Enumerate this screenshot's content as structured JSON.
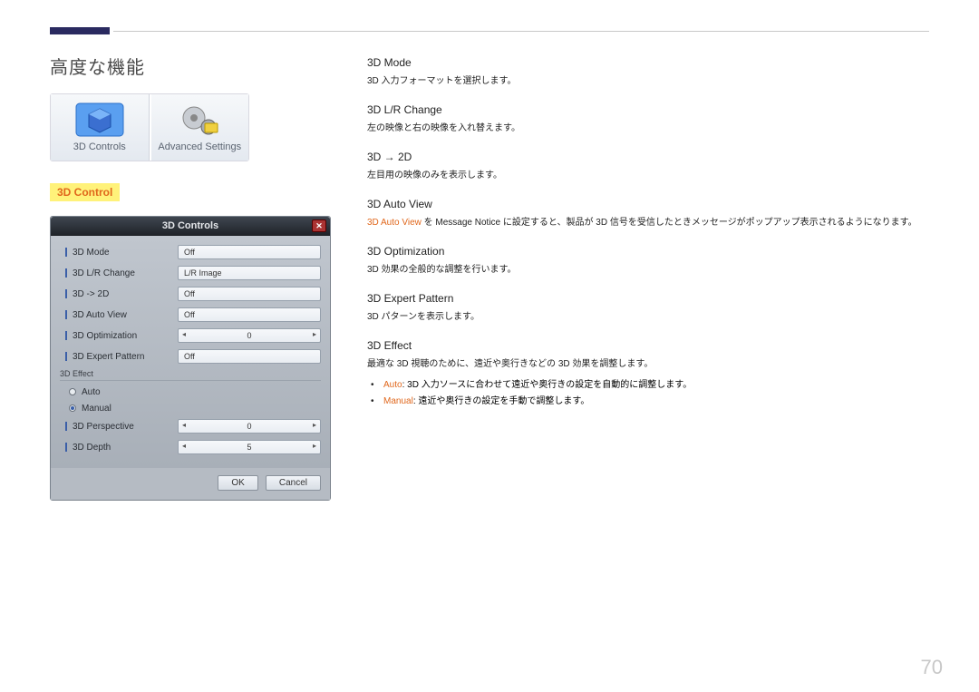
{
  "page_title": "高度な機能",
  "tiles": [
    {
      "label": "3D Controls"
    },
    {
      "label": "Advanced Settings"
    }
  ],
  "section_highlight": "3D Control",
  "dialog": {
    "title": "3D Controls",
    "close_glyph": "✕",
    "rows": [
      {
        "label": "3D Mode",
        "value": "Off"
      },
      {
        "label": "3D L/R Change",
        "value": "L/R Image"
      },
      {
        "label": "3D -> 2D",
        "value": "Off"
      },
      {
        "label": "3D Auto View",
        "value": "Off"
      },
      {
        "label": "3D Optimization",
        "value": "0",
        "spinner": true
      },
      {
        "label": "3D Expert Pattern",
        "value": "Off"
      }
    ],
    "effect_group_label": "3D Effect",
    "radios": [
      {
        "label": "Auto",
        "on": false
      },
      {
        "label": "Manual",
        "on": true
      }
    ],
    "effect_rows": [
      {
        "label": "3D Perspective",
        "value": "0",
        "spinner": true
      },
      {
        "label": "3D Depth",
        "value": "5",
        "spinner": true
      }
    ],
    "ok_label": "OK",
    "cancel_label": "Cancel"
  },
  "defs": [
    {
      "h": "3D Mode",
      "p": "3D 入力フォーマットを選択します。"
    },
    {
      "h": "3D L/R Change",
      "p": "左の映像と右の映像を入れ替えます。"
    },
    {
      "h": "3D → 2D",
      "p": "左目用の映像のみを表示します。"
    },
    {
      "h": "3D Auto View",
      "p_pre": "3D Auto View",
      "p_mid": " を Message Notice に設定すると、製品が 3D 信号を受信したときメッセージがポップアップ表示されるようになります。"
    },
    {
      "h": "3D Optimization",
      "p": "3D 効果の全般的な調整を行います。"
    },
    {
      "h": "3D Expert Pattern",
      "p": "3D パターンを表示します。"
    },
    {
      "h": "3D Effect",
      "p": "最適な 3D 視聴のために、遠近や奥行きなどの 3D 効果を調整します。"
    }
  ],
  "bullets": [
    {
      "accent": "Auto",
      "text": ": 3D 入力ソースに合わせて遠近や奥行きの設定を自動的に調整します。"
    },
    {
      "accent": "Manual",
      "text": ": 遠近や奥行きの設定を手動で調整します。"
    }
  ],
  "page_number": "70"
}
